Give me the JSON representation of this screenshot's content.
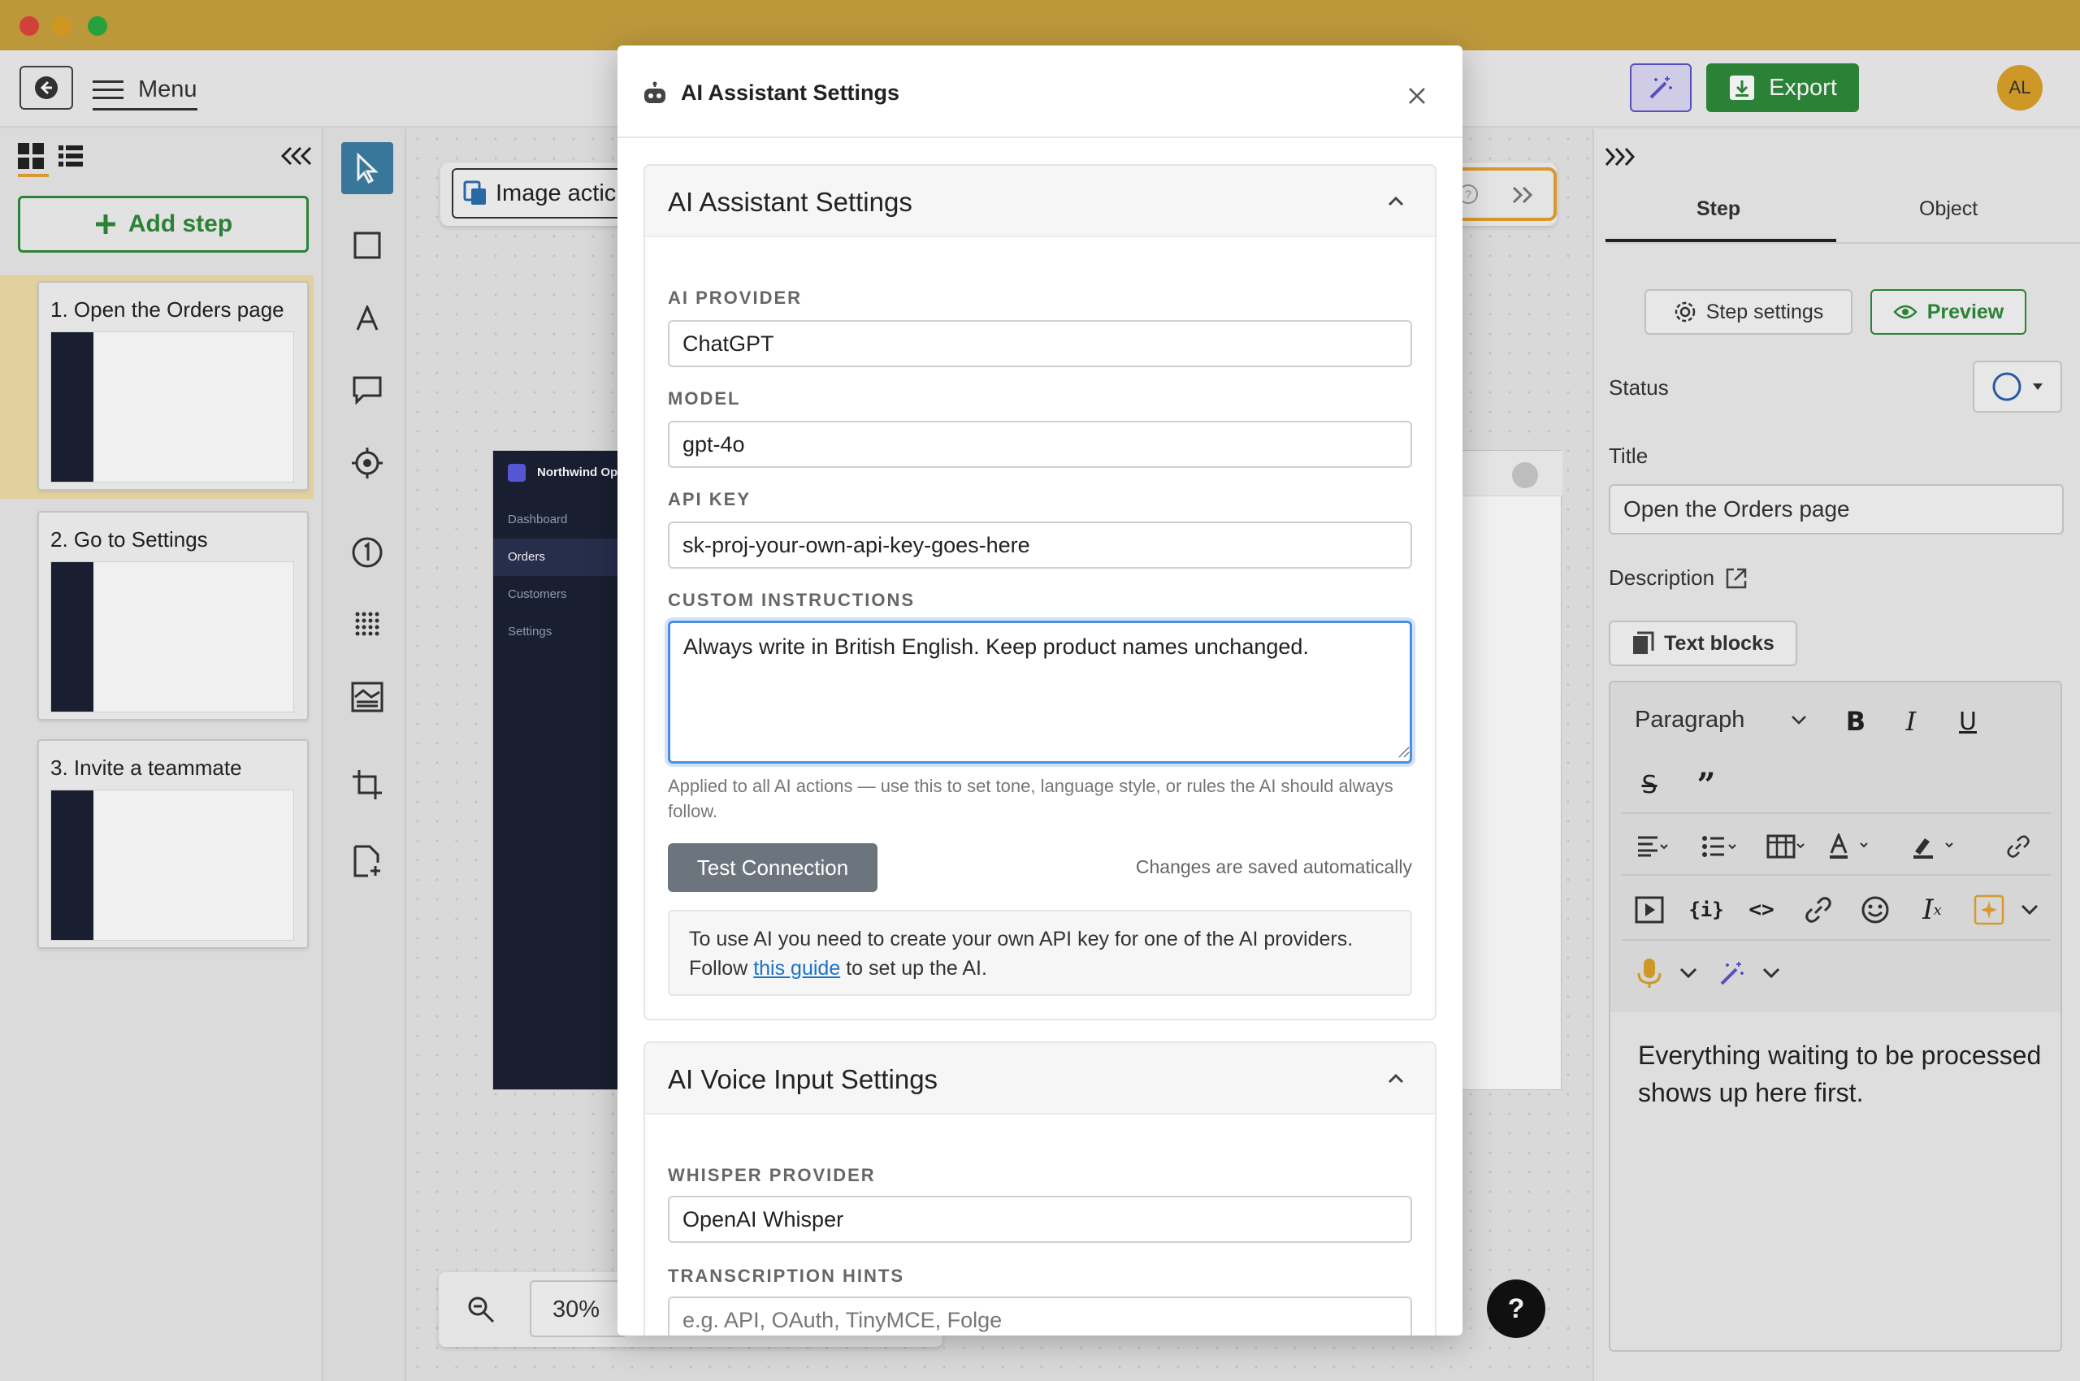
{
  "app": {
    "menu_label": "Menu",
    "export_label": "Export",
    "avatar_initials": "AL"
  },
  "left_panel": {
    "add_step_label": "Add step",
    "steps": [
      {
        "title": "1. Open the Orders page"
      },
      {
        "title": "2. Go to Settings"
      },
      {
        "title": "3. Invite a teammate"
      }
    ]
  },
  "canvas": {
    "image_action_label": "Image actic",
    "zoom_value": "30%",
    "preview": {
      "brand": "Northwind Op",
      "nav": [
        "Dashboard",
        "Orders",
        "Customers",
        "Settings"
      ]
    },
    "help_label": "?"
  },
  "right_panel": {
    "tabs": [
      "Step",
      "Object"
    ],
    "active_tab": "Step",
    "step_settings_label": "Step settings",
    "preview_label": "Preview",
    "status_label": "Status",
    "title_label": "Title",
    "title_value": "Open the Orders page",
    "description_label": "Description",
    "text_blocks_label": "Text blocks",
    "paragraph_style": "Paragraph",
    "editor_text": "Everything waiting to be processed shows up here first."
  },
  "modal": {
    "title": "AI Assistant Settings",
    "ai_section": {
      "title": "AI Assistant Settings",
      "provider_label": "AI PROVIDER",
      "provider_value": "ChatGPT",
      "model_label": "MODEL",
      "model_value": "gpt-4o",
      "api_key_label": "API KEY",
      "api_key_value": "sk-proj-your-own-api-key-goes-here",
      "instructions_label": "CUSTOM INSTRUCTIONS",
      "instructions_value": "Always write in British English. Keep product names unchanged.",
      "instructions_hint": "Applied to all AI actions — use this to set tone, language style, or rules the AI should always follow.",
      "test_button": "Test Connection",
      "saved_note": "Changes are saved automatically",
      "info_line1": "To use AI you need to create your own API key for one of the AI providers.",
      "info_follow": "Follow",
      "info_link": "this guide",
      "info_rest": "to set up the AI."
    },
    "voice_section": {
      "title": "AI Voice Input Settings",
      "whisper_label": "WHISPER PROVIDER",
      "whisper_value": "OpenAI Whisper",
      "hints_label": "TRANSCRIPTION HINTS",
      "hints_placeholder": "e.g. API, OAuth, TinyMCE, Folge"
    }
  },
  "colors": {
    "titlebar": "#c9a23f",
    "brand_green": "#2e8b3a",
    "focus_blue": "#4a90e2",
    "accent_orange": "#e6a232",
    "sidebar_dark": "#1b2135"
  }
}
